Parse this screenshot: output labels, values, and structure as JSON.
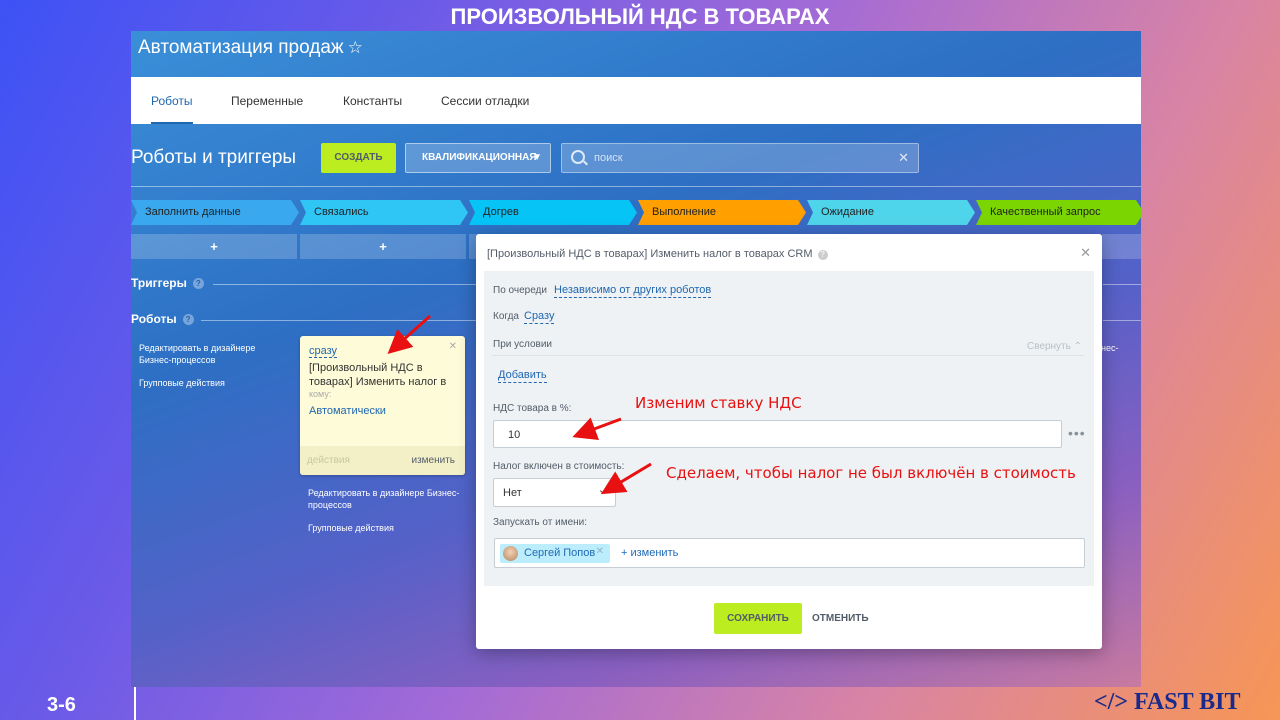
{
  "slide": {
    "title": "ПРОИЗВОЛЬНЫЙ НДС В ТОВАРАХ",
    "number": "3-6",
    "brand": "</> FAST BIT"
  },
  "app": {
    "title": "Автоматизация продаж",
    "star_icon": "star-icon"
  },
  "tabs": [
    {
      "label": "Роботы",
      "active": true
    },
    {
      "label": "Переменные",
      "active": false
    },
    {
      "label": "Константы",
      "active": false
    },
    {
      "label": "Сессии отладки",
      "active": false
    }
  ],
  "toolbar": {
    "section_title": "Роботы и триггеры",
    "create_label": "СОЗДАТЬ",
    "category_label": "КВАЛИФИКАЦИОННАЯ",
    "search_placeholder": "поиск"
  },
  "stages": [
    {
      "label": "Заполнить данные",
      "color": "#39a8ef"
    },
    {
      "label": "Связались",
      "color": "#2fc6f6"
    },
    {
      "label": "Догрев",
      "color": "#07c4f7"
    },
    {
      "label": "Выполнение",
      "color": "#ff9f00"
    },
    {
      "label": "Ожидание",
      "color": "#4fd5eb"
    },
    {
      "label": "Качественный запрос",
      "color": "#7bd500"
    }
  ],
  "add_symbol": "+",
  "triggers_label": "Триггеры",
  "robots_label": "Роботы",
  "left_links": {
    "designer": "Редактировать в дизайнере Бизнес-процессов",
    "group": "Групповые действия"
  },
  "right_link_fragment": "нес-",
  "robot_card": {
    "when": "сразу",
    "title": "[Произвольный НДС в товарах] Изменить налог в",
    "to_label": "кому:",
    "auto": "Автоматически",
    "actions": "действия",
    "change": "изменить"
  },
  "modal": {
    "title": "[Произвольный НДС в товарах] Изменить налог в товарах CRM",
    "queue_label": "По очереди",
    "queue_value": "Независимо от других роботов",
    "when_label": "Когда",
    "when_value": "Сразу",
    "condition_label": "При условии",
    "collapse_label": "Свернуть",
    "add_label": "Добавить",
    "vat_label": "НДС товара в %:",
    "vat_value": "10",
    "tax_included_label": "Налог включен в стоимость:",
    "tax_included_value": "Нет",
    "run_as_label": "Запускать от имени:",
    "user_name": "Сергей Попов",
    "user_change": "+ изменить",
    "save_label": "СОХРАНИТЬ",
    "cancel_label": "ОТМЕНИТЬ"
  },
  "annotations": {
    "vat_note": "Изменим ставку НДС",
    "tax_note": "Сделаем, чтобы налог не был включён в стоимость"
  },
  "colors": {
    "accent_green": "#bbed21",
    "link_blue": "#2067b0",
    "annotation_red": "#e81010"
  }
}
